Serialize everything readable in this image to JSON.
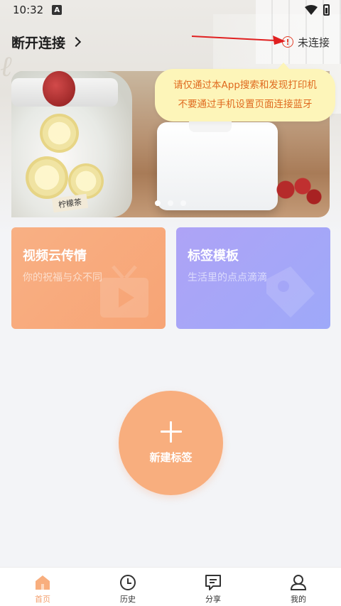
{
  "status_bar": {
    "time": "10:32",
    "notification_icon": "A"
  },
  "header": {
    "device_name": "断开连接",
    "connection_status": "未连接"
  },
  "tooltip": {
    "line1": "请仅通过本App搜索和发现打印机",
    "line2": "不要通过手机设置页面连接蓝牙"
  },
  "banner": {
    "jar_label": "柠檬茶",
    "slides": 3,
    "active_slide": 1
  },
  "cards": [
    {
      "title": "视频云传情",
      "subtitle": "你的祝福与众不同"
    },
    {
      "title": "标签模板",
      "subtitle": "生活里的点点滴滴"
    }
  ],
  "new_button": {
    "label": "新建标签"
  },
  "bottom_nav": [
    {
      "label": "首页",
      "icon": "home-icon",
      "active": true
    },
    {
      "label": "历史",
      "icon": "clock-icon",
      "active": false
    },
    {
      "label": "分享",
      "icon": "share-icon",
      "active": false
    },
    {
      "label": "我的",
      "icon": "profile-icon",
      "active": false
    }
  ],
  "colors": {
    "accent": "#f8ae7e",
    "video_card": "#f8b084",
    "label_card": "#aea3f6",
    "tooltip_bg": "#fdf5b9",
    "tooltip_text": "#e06a1f",
    "warning": "#e2402b"
  }
}
